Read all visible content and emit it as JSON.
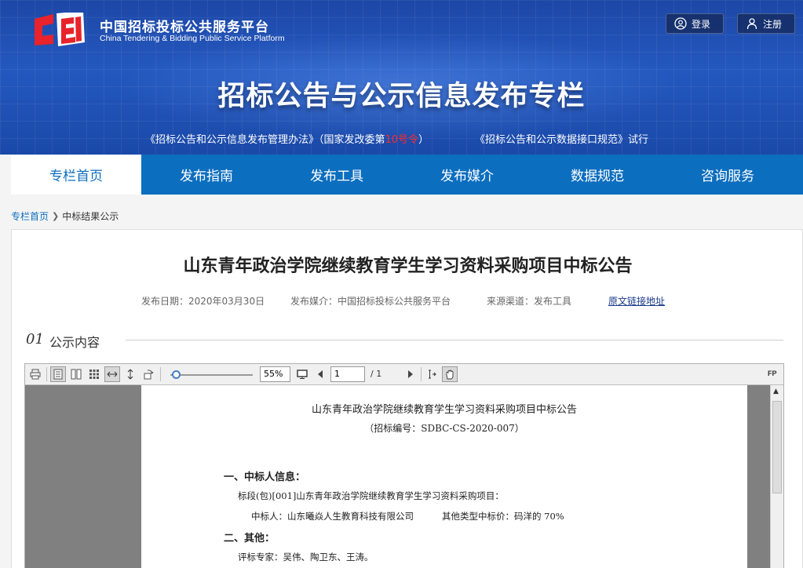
{
  "header": {
    "brand_cn": "中国招标投标公共服务平台",
    "brand_en": "China Tendering & Bidding Public Service Platform",
    "login_label": "登录",
    "register_label": "注册",
    "banner_title": "招标公告与公示信息发布专栏",
    "policy_a_prefix": "《招标公告和公示信息发布管理办法》（国家发改委第",
    "policy_a_number": "10号令",
    "policy_a_suffix": "）",
    "policy_b": "《招标公告和公示数据接口规范》试行"
  },
  "nav": {
    "items": [
      {
        "label": "专栏首页"
      },
      {
        "label": "发布指南"
      },
      {
        "label": "发布工具"
      },
      {
        "label": "发布媒介"
      },
      {
        "label": "数据规范"
      },
      {
        "label": "咨询服务"
      }
    ]
  },
  "breadcrumb": {
    "home": "专栏首页",
    "current": "中标结果公示"
  },
  "article": {
    "title": "山东青年政治学院继续教育学生学习资料采购项目中标公告",
    "publish_date": "发布日期：2020年03月30日",
    "media": "发布媒介：中国招标投标公共服务平台",
    "source": "来源渠道：发布工具",
    "original_link": "原文链接地址",
    "section_num": "01",
    "section_label": "公示内容"
  },
  "viewer": {
    "zoom": "55%",
    "zoom_fraction": 0.05,
    "page_current": "1",
    "page_total": "/ 1",
    "fp_label": "FP",
    "doc": {
      "title": "山东青年政治学院继续教育学生学习资料采购项目中标公告",
      "code": "（招标编号：SDBC-CS-2020-007）",
      "h1": "一、中标人信息：",
      "lot": "标段(包)[001]山东青年政治学院继续教育学生学习资料采购项目：",
      "winner": "中标人：山东曦焱人生教育科技有限公司",
      "price": "其他类型中标价：码洋的 70%",
      "h2": "二、其他：",
      "experts": "评标专家：吴伟、陶卫东、王涛。"
    }
  },
  "colors": {
    "nav_blue": "#0c6ebf",
    "header_blue": "#2458bf",
    "link": "#1a3a8c",
    "alert_red": "#ff2a2a"
  }
}
